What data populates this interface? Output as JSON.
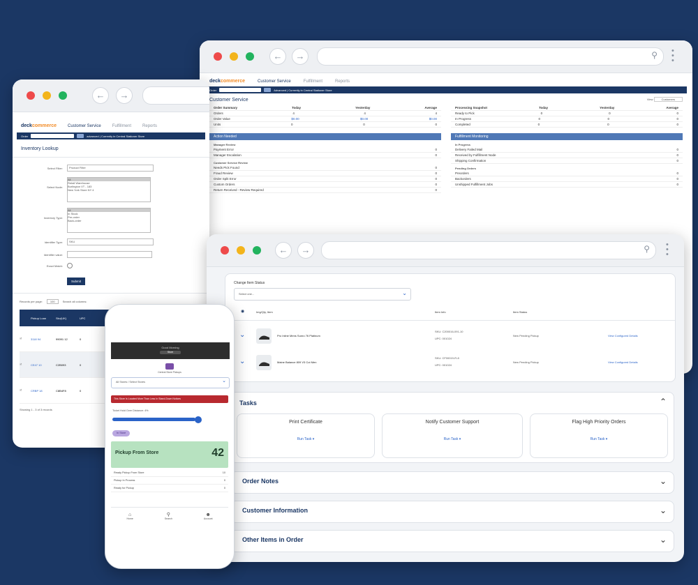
{
  "colors": {
    "background": "#1b3764",
    "accent": "#2a63c8",
    "orange": "#f28c28",
    "pickup_green": "#b7e2c0",
    "alert_red": "#b8292f"
  },
  "brand": {
    "logo_left": "deck",
    "logo_right": "commerce"
  },
  "win_back": {
    "nav_tabs": [
      "Customer Service",
      "Fulfillment",
      "Reports"
    ],
    "search_label": "Order",
    "bar_text": "Advanced  |  Currently in Central Stationer Store",
    "title": "Customer Service",
    "view_label": "View",
    "view_value": "Customers",
    "left_table": {
      "headers": [
        "Order Summary",
        "Today",
        "Yesterday",
        "Average"
      ],
      "rows": [
        [
          "Orders",
          "4",
          "4",
          "4"
        ],
        [
          "Order Value",
          "$0.00",
          "$0.00",
          "$0.00"
        ],
        [
          "Units",
          "0",
          "0",
          "0"
        ]
      ]
    },
    "right_table": {
      "headers": [
        "Processing Snapshot",
        "Today",
        "Yesterday",
        "Average"
      ],
      "rows": [
        [
          "Ready to Pick",
          "0",
          "0",
          "0"
        ],
        [
          "In Progress",
          "0",
          "0",
          "0"
        ],
        [
          "Completed",
          "0",
          "0",
          "0"
        ]
      ]
    },
    "left_section": "Action Needed",
    "left_groups": [
      {
        "title": "Manager Review",
        "items": [
          [
            "Payment Error",
            "0"
          ],
          [
            "Manager Escalation",
            "0"
          ]
        ]
      },
      {
        "title": "Customer Service Review",
        "items": [
          [
            "Needs Pick Found",
            "0"
          ],
          [
            "Fraud Review",
            "0"
          ],
          [
            "Order Split Error",
            "0"
          ],
          [
            "Custom Orders",
            "0"
          ],
          [
            "Return Received - Review Required",
            "0"
          ]
        ]
      }
    ],
    "right_section": "Fulfillment Monitoring",
    "right_groups": [
      {
        "title": "In Progress",
        "items": [
          [
            "Delivery Failed Mail",
            "0"
          ],
          [
            "Received by Fulfillment Node",
            "0"
          ],
          [
            "Shipping Confirmation",
            "0"
          ]
        ]
      },
      {
        "title": "Pending Orders",
        "items": [
          [
            "Preorders",
            "0"
          ],
          [
            "Backorders",
            "0"
          ],
          [
            "Unshipped Fulfillment Jobs",
            "0"
          ]
        ]
      }
    ]
  },
  "win_left": {
    "nav_tabs": [
      "Customer Service",
      "Fulfillment",
      "Reports"
    ],
    "search_label": "Order",
    "bar_text": "advanced  |  Currently in Central Stationer Store",
    "title": "Inventory Lookup",
    "fields": [
      {
        "label": "Select Filter:",
        "value": "Product Filter"
      },
      {
        "label": "Select Node:",
        "options": [
          "All",
          "Retail Warehouse",
          "Burlington VT - 183",
          "New York Store NY 4"
        ]
      },
      {
        "label": "Inventory Type:",
        "options": [
          "All",
          "In Stock",
          "Pre-order",
          "Back-order"
        ]
      },
      {
        "label": "Identifier Type:",
        "value": "SKU"
      },
      {
        "label": "Identifier value:",
        "value": ""
      },
      {
        "label": "Exact Match:",
        "value": ""
      }
    ],
    "submit": "Submit",
    "records_label": "Records per page:",
    "records_value": "100",
    "search_label2": "Search all columns:",
    "table_headers": [
      "",
      "Pickup Loan",
      "Sku(UK)",
      "UPC"
    ],
    "table_rows": [
      [
        "3118 94",
        "99091 12",
        "0"
      ],
      [
        "CE47 10",
        "C2B093",
        "0"
      ],
      [
        "CRBP 18",
        "C8B4F8",
        "0"
      ]
    ],
    "footer": "Showing 1 - 3 of 3 records"
  },
  "phone": {
    "header_text": "Good Morning",
    "header_badge": "Store",
    "store_name": "Central Store Pickups",
    "select_text": "All Stores / Select Stores",
    "alert": "This Store Is Located More Than Less In Stand-Down Notices",
    "progress_label": "Ticket Hold Over Distance: 4%",
    "progress_fraction": 0.96,
    "chip": "In Store",
    "pickup_title": "Pickup From Store",
    "pickup_count": "42",
    "list": [
      [
        "Ready Pickup From Store",
        "10"
      ],
      [
        "Pickup In Process",
        "0"
      ],
      [
        "Ready for Pickup",
        "0"
      ]
    ],
    "bottom_nav": [
      "Home",
      "Search",
      "Account"
    ]
  },
  "win_front": {
    "change_label": "Change Item Status",
    "select_placeholder": "Select one...",
    "table_headers": [
      "Img/Qty, Item",
      "Item Info",
      "Item Status"
    ],
    "items": [
      {
        "name": "Pro Inline Mens Sunro 76 Platinum",
        "sku": "SKU: C200016-091-10",
        "upc": "UPC: 001024",
        "status": "New Pending Pickup",
        "link": "View Configured Details"
      },
      {
        "name": "Maine Balance 809 V3 Cut Men",
        "sku": "SKU: CF00019-R-8",
        "upc": "UPC: 001024",
        "status": "New Pending Pickup",
        "link": "View Configured Details"
      }
    ],
    "tasks_title": "Tasks",
    "tasks": [
      {
        "title": "Print Certificate",
        "action": "Run Task"
      },
      {
        "title": "Notify Customer Support",
        "action": "Run Task"
      },
      {
        "title": "Flag High Priority Orders",
        "action": "Run Task"
      }
    ],
    "accordions": [
      "Order Notes",
      "Customer Information",
      "Other Items in Order"
    ]
  }
}
